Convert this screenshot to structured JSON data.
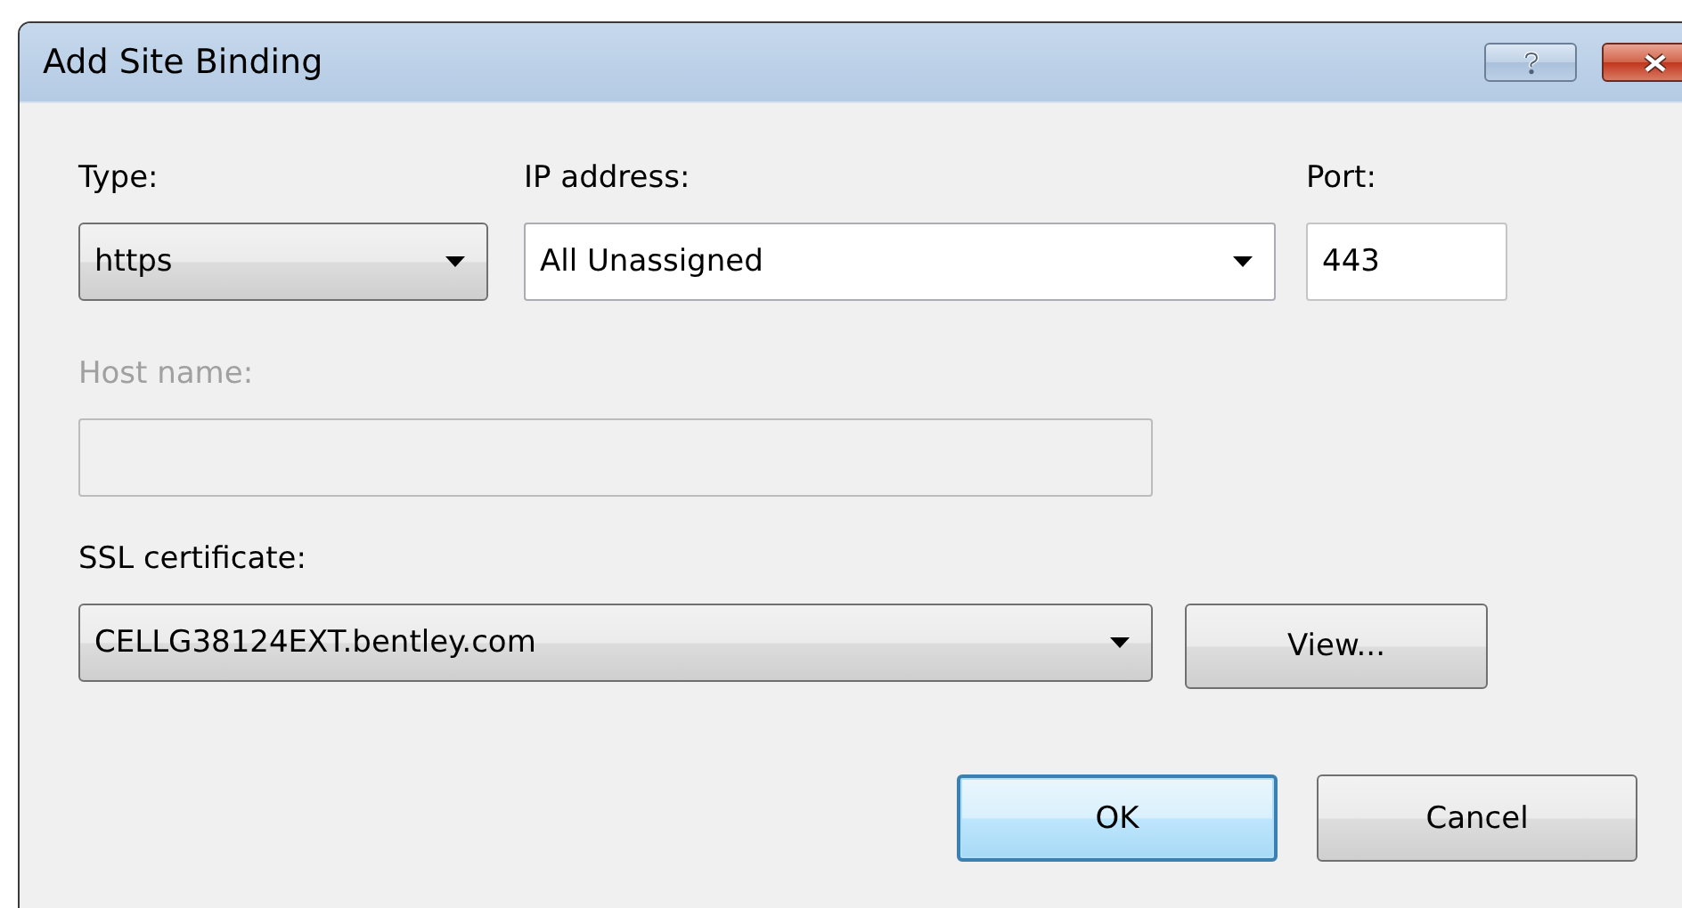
{
  "window": {
    "title": "Add Site Binding",
    "title_buttons": [
      {
        "kind": "help"
      },
      {
        "kind": "close"
      }
    ]
  },
  "row": [
    {
      "label": "Type:",
      "value": "https",
      "kind": "dropdown"
    },
    {
      "label": "IP address:",
      "value": "All Unassigned",
      "kind": "combo"
    },
    {
      "label": "Port:",
      "value": "443",
      "kind": "text"
    }
  ],
  "host": {
    "label": "Host name:",
    "disabled": true
  },
  "ssl": {
    "label": "SSL certificate:",
    "value": "CELLG38124EXT.bentley.com",
    "kind": "dropdown",
    "button": "View..."
  },
  "buttons": [
    {
      "label": "OK",
      "default": true
    },
    {
      "label": "Cancel",
      "default": false
    }
  ]
}
